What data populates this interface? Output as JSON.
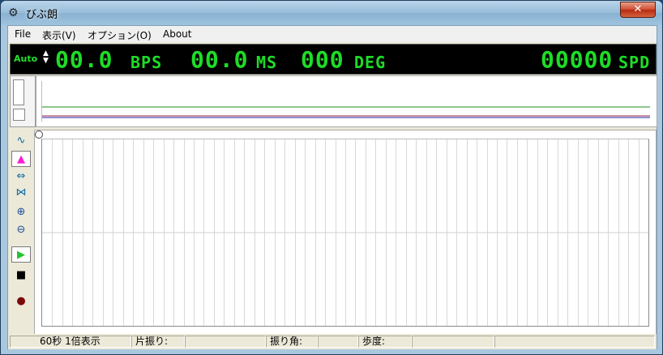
{
  "window": {
    "title": "びぶ朗",
    "close_glyph": "✕",
    "app_icon": "app-icon"
  },
  "menu": [
    "File",
    "表示(V)",
    "オプション(O)",
    "About"
  ],
  "readout": {
    "mode": "Auto",
    "speed_value": "00.0",
    "speed_unit": "BPS",
    "time_value": "00.0",
    "time_unit": "MS",
    "angle_value": "000",
    "angle_unit": "DEG",
    "count_value": "00000",
    "count_unit": "SPD",
    "led_color": "#1edc27"
  },
  "tools": [
    {
      "name": "waveform-tool-button",
      "icon": "sine-wave-icon",
      "glyph": "∿"
    },
    {
      "name": "spectrum-tool-button",
      "icon": "spectrum-icon",
      "glyph": "▲"
    },
    {
      "name": "expand-tool-button",
      "icon": "expand-arrows-icon",
      "glyph": "⇔"
    },
    {
      "name": "shrink-tool-button",
      "icon": "shrink-arrows-icon",
      "glyph": "⋈"
    },
    {
      "name": "zoom-in-tool-button",
      "icon": "zoom-in-icon",
      "glyph": "⊕"
    },
    {
      "name": "zoom-out-tool-button",
      "icon": "zoom-out-icon",
      "glyph": "⊖"
    },
    {
      "name": "play-button",
      "icon": "play-icon",
      "glyph": "▶"
    },
    {
      "name": "stop-button",
      "icon": "stop-icon",
      "glyph": "■"
    },
    {
      "name": "record-button",
      "icon": "record-icon",
      "glyph": "●"
    }
  ],
  "status": {
    "display": "60秒 1倍表示",
    "amplitude_label": "片振り:",
    "amplitude_value": "",
    "swing_angle_label": "振り角:",
    "swing_angle_value": "",
    "steps_label": "歩度:",
    "steps_value": ""
  }
}
